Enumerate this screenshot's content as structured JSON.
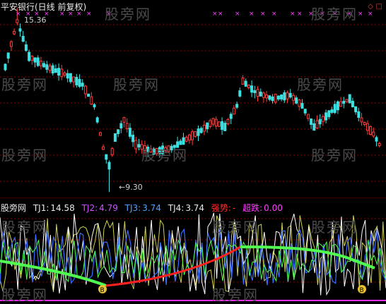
{
  "chart_title": "平安银行(日线 前复权)",
  "high_label": "15.36",
  "low_label": "9.30",
  "watermark": "股旁网",
  "indicator": {
    "name": "股旁网",
    "items": [
      {
        "label": "TJ1:",
        "value": "14.58",
        "color": "#e8e8e8"
      },
      {
        "label": "TJ2:",
        "value": "4.79",
        "color": "#d050ff"
      },
      {
        "label": "TJ3:",
        "value": "3.74",
        "color": "#4fa0ff"
      },
      {
        "label": "TJ4:",
        "value": "3.74",
        "color": "#e8e8e8"
      },
      {
        "label": "强势:",
        "value": "-",
        "color": "#ff3030"
      },
      {
        "label": "超跌:",
        "value": "0.00",
        "color": "#ff40ff"
      }
    ],
    "marker_text": "B"
  },
  "colors": {
    "up": "#ff3c3c",
    "down": "#3ce0e0",
    "grid": "#8a0000",
    "marker": "#ff40ff",
    "tj1": "#ffffff",
    "tj2": "#d0d050",
    "tj3": "#3a6cff",
    "line_green": "#50ff50",
    "line_red": "#ff2020"
  },
  "corner_icons": [
    "diamond-icon",
    "square-icon"
  ]
}
